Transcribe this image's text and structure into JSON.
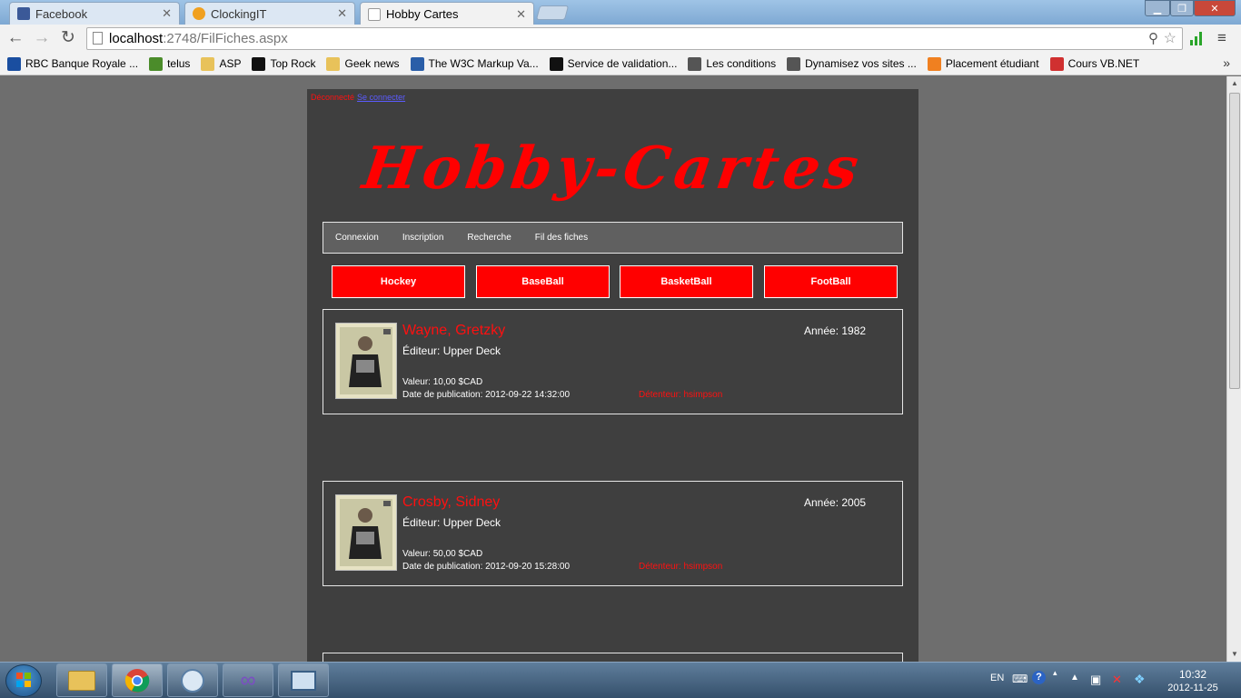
{
  "browser": {
    "tabs": [
      {
        "title": "Facebook",
        "icon": "facebook-icon",
        "color": "#3b5998"
      },
      {
        "title": "ClockingIT",
        "icon": "clockingit-icon",
        "color": "#f0a020"
      },
      {
        "title": "Hobby Cartes",
        "icon": "page-icon",
        "color": "#ffffff"
      }
    ],
    "tab_close": "✕",
    "url_host": "localhost",
    "url_path": ":2748/FilFiches.aspx",
    "bookmarks": [
      {
        "label": "RBC Banque Royale ...",
        "icon": "rbc-icon",
        "color": "#1a4ea0"
      },
      {
        "label": "telus",
        "icon": "telus-icon",
        "color": "#4b8c2a"
      },
      {
        "label": "ASP",
        "icon": "folder-icon",
        "color": "#e8c25a"
      },
      {
        "label": "Top Rock",
        "icon": "toprock-icon",
        "color": "#111111"
      },
      {
        "label": "Geek news",
        "icon": "folder-icon",
        "color": "#e8c25a"
      },
      {
        "label": "The W3C Markup Va...",
        "icon": "w3c-icon",
        "color": "#2a5ea8"
      },
      {
        "label": "Service de validation...",
        "icon": "validation-icon",
        "color": "#111111"
      },
      {
        "label": "Les conditions",
        "icon": "page-icon",
        "color": "#555555"
      },
      {
        "label": "Dynamisez vos sites ...",
        "icon": "page-icon",
        "color": "#555555"
      },
      {
        "label": "Placement étudiant",
        "icon": "placement-icon",
        "color": "#f08020"
      },
      {
        "label": "Cours VB.NET",
        "icon": "vbnet-icon",
        "color": "#d03030"
      }
    ]
  },
  "page": {
    "status": "Déconnecté",
    "login_link": "Se connecter",
    "logo": "Hobby-Cartes",
    "menu": [
      "Connexion",
      "Inscription",
      "Recherche",
      "Fil des fiches"
    ],
    "categories": [
      "Hockey",
      "BaseBall",
      "BasketBall",
      "FootBall"
    ],
    "cards": [
      {
        "name": "Wayne, Gretzky",
        "year": "Année: 1982",
        "editor": "Éditeur: Upper Deck",
        "value": "Valeur: 10,00 $CAD",
        "date": "Date de publication: 2012-09-22 14:32:00",
        "owner": "Détenteur: hsimpson"
      },
      {
        "name": "Crosby, Sidney",
        "year": "Année: 2005",
        "editor": "Éditeur: Upper Deck",
        "value": "Valeur: 50,00 $CAD",
        "date": "Date de publication: 2012-09-20 15:28:00",
        "owner": "Détenteur: hsimpson"
      }
    ]
  },
  "taskbar": {
    "lang": "EN",
    "time": "10:32",
    "date": "2012-11-25"
  }
}
